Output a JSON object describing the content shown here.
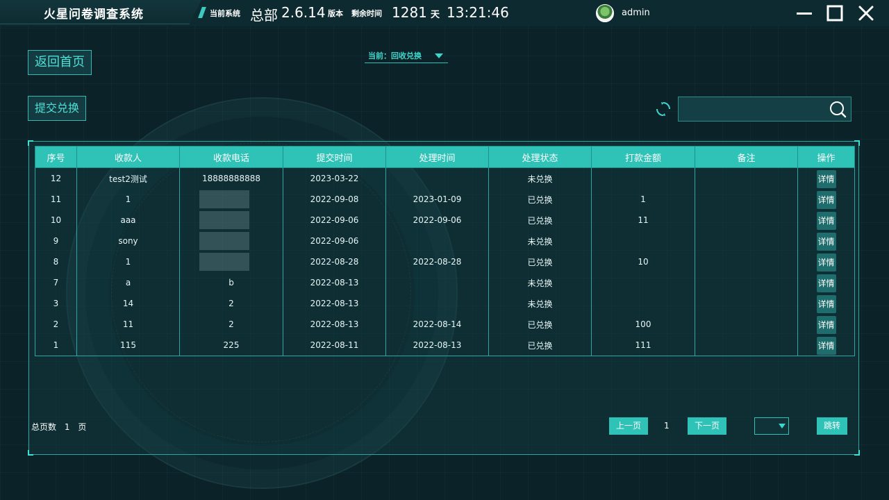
{
  "app": {
    "title": "火星问卷调查系统"
  },
  "topbar": {
    "current_system_label": "当前系统",
    "system_name": "总部",
    "version_number": "2.6.14",
    "version_label": "版本",
    "remaining_label": "剩余时间",
    "remaining_days": "1281",
    "days_unit": "天",
    "clock": "13:21:46",
    "username": "admin"
  },
  "actions": {
    "home_label": "返回首页",
    "submit_label": "提交兑换"
  },
  "dropdown": {
    "label": "当前：回收兑换"
  },
  "search": {
    "placeholder": ""
  },
  "table": {
    "headers": [
      "序号",
      "收款人",
      "收款电话",
      "提交时间",
      "处理时间",
      "处理状态",
      "打款金额",
      "备注",
      "操作"
    ],
    "detail_label": "详情",
    "rows": [
      [
        "12",
        "test2测试",
        "18888888888",
        "2023-03-22",
        "",
        "未兑换",
        "",
        ""
      ],
      [
        "11",
        "1",
        "",
        "2022-09-08",
        "2023-01-09",
        "已兑换",
        "1",
        ""
      ],
      [
        "10",
        "aaa",
        "",
        "2022-09-06",
        "2022-09-06",
        "已兑换",
        "11",
        ""
      ],
      [
        "9",
        "sony",
        "",
        "2022-09-06",
        "",
        "未兑换",
        "",
        ""
      ],
      [
        "8",
        "1",
        "",
        "2022-08-28",
        "2022-08-28",
        "已兑换",
        "10",
        ""
      ],
      [
        "7",
        "a",
        "b",
        "2022-08-13",
        "",
        "未兑换",
        "",
        ""
      ],
      [
        "3",
        "14",
        "2",
        "2022-08-13",
        "",
        "未兑换",
        "",
        ""
      ],
      [
        "2",
        "11",
        "2",
        "2022-08-13",
        "2022-08-14",
        "已兑换",
        "100",
        ""
      ],
      [
        "1",
        "115",
        "225",
        "2022-08-11",
        "2022-08-13",
        "已兑换",
        "111",
        ""
      ]
    ],
    "blurred_phone_rows": [
      1,
      2,
      3,
      4
    ]
  },
  "pagination": {
    "total_label": "总页数",
    "total_pages": "1",
    "pages_unit": "页",
    "prev_label": "上一页",
    "current_page": "1",
    "next_label": "下一页",
    "jump_label": "跳转"
  },
  "colors": {
    "accent": "#2fc3b8",
    "background": "#0b2228",
    "text_accent": "#4ee0d6"
  },
  "icons": [
    "minimize-icon",
    "maximize-icon",
    "close-icon",
    "refresh-icon",
    "search-icon",
    "chevron-down-icon"
  ]
}
